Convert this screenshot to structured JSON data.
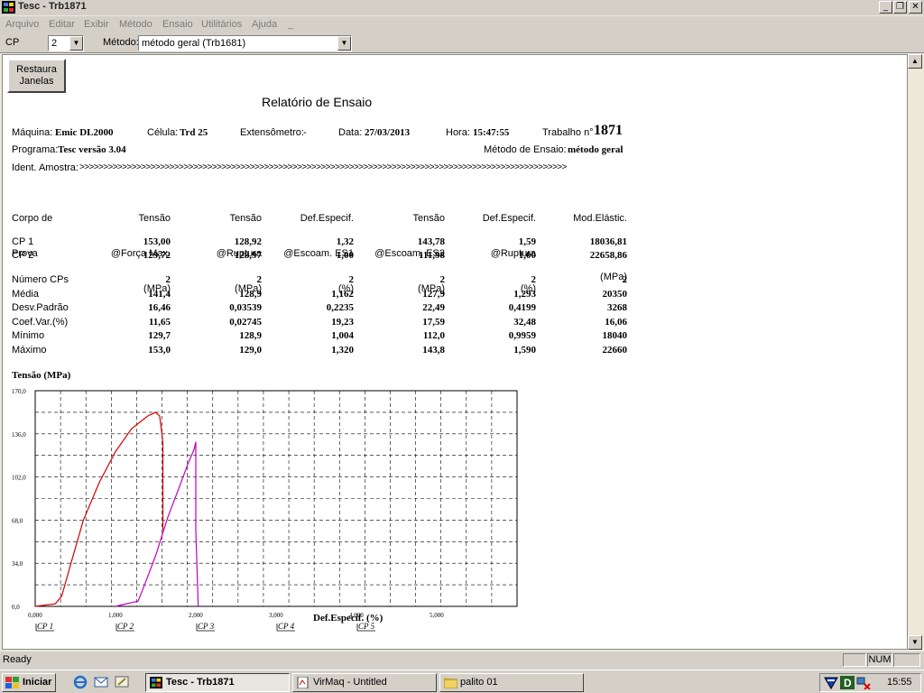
{
  "window": {
    "title": "Tesc - Trb1871",
    "controls": {
      "minimize": "_",
      "restore": "❐",
      "close": "✕"
    }
  },
  "menu": [
    "Arquivo",
    "Editar",
    "Exibir",
    "Método",
    "Ensaio",
    "Utilitários",
    "Ajuda",
    "_"
  ],
  "toolbar": {
    "cp_label": "CP",
    "cp_value": "2",
    "metodo_label": "Método:",
    "metodo_value": "método geral (Trb1681)"
  },
  "report": {
    "restore_button": [
      "Restaura",
      "Janelas"
    ],
    "title": "Relatório de Ensaio",
    "header": {
      "maquina_label": "Máquina:",
      "maquina_value": "Emic DL2000",
      "celula_label": "Célula:",
      "celula_value": "Trd 25",
      "extensometro_label": "Extensômetro:",
      "extensometro_value": "-",
      "data_label": "Data:",
      "data_value": "27/03/2013",
      "hora_label": "Hora:",
      "hora_value": "15:47:55",
      "trabalho_label": "Trabalho n°",
      "trabalho_value": "1871",
      "programa_label": "Programa:",
      "programa_value": "Tesc versão 3.04",
      "metodo_label": "Método de Ensaio:",
      "metodo_value": "método geral",
      "amostra_label": "Ident. Amostra:",
      "amostra_value": ">>>>>>>>>>>>>>>>>>>>>>>>>>>>>>>>>>>>>>>>>>>>>>>>>>>>>>>>>>>>>>>>>>>>>>>>>>>>>>>>>>>>>>>>>>>>>>>>>>>>>>>"
    },
    "columns": [
      {
        "lines": [
          "Corpo de",
          "Prova",
          ""
        ]
      },
      {
        "lines": [
          "Tensão",
          "@Força Max.",
          "(MPa)"
        ]
      },
      {
        "lines": [
          "Tensão",
          "@Ruptura",
          "(MPa)"
        ]
      },
      {
        "lines": [
          "Def.Especif.",
          "@Escoam. ES1",
          "(%)"
        ]
      },
      {
        "lines": [
          "Tensão",
          "@Escoam. ES2",
          "(MPa)"
        ]
      },
      {
        "lines": [
          "Def.Especif.",
          "@Ruptura",
          "(%)"
        ]
      },
      {
        "lines": [
          "Mod.Elástic.",
          "",
          "(MPa)"
        ]
      }
    ],
    "rows": [
      {
        "label": "CP 1",
        "values": [
          "153,00",
          "128,92",
          "1,32",
          "143,78",
          "1,59",
          "18036,81"
        ]
      },
      {
        "label": "CP 2",
        "values": [
          "129,72",
          "128,97",
          "1,00",
          "111,98",
          "1,00",
          "22658,86"
        ]
      }
    ],
    "stats": [
      {
        "label": "Número CPs",
        "values": [
          "2",
          "2",
          "2",
          "2",
          "2",
          "2"
        ]
      },
      {
        "label": "Média",
        "values": [
          "141,4",
          "128,9",
          "1,162",
          "127,9",
          "1,293",
          "20350"
        ]
      },
      {
        "label": "Desv.Padrão",
        "values": [
          "16,46",
          "0,03539",
          "0,2235",
          "22,49",
          "0,4199",
          "3268"
        ]
      },
      {
        "label": "Coef.Var.(%)",
        "values": [
          "11,65",
          "0,02745",
          "19,23",
          "17,59",
          "32,48",
          "16,06"
        ]
      },
      {
        "label": "Mínimo",
        "values": [
          "129,7",
          "128,9",
          "1,004",
          "112,0",
          "0,9959",
          "18040"
        ]
      },
      {
        "label": "Máximo",
        "values": [
          "153,0",
          "129,0",
          "1,320",
          "143,8",
          "1,590",
          "22660"
        ]
      }
    ]
  },
  "chart_data": {
    "type": "line",
    "ylabel": "Tensão (MPa)",
    "xlabel": "Def.Especif. (%)",
    "xlim": [
      0,
      6
    ],
    "ylim": [
      0,
      170
    ],
    "ytick_labels": [
      "0,0",
      "34,0",
      "68,0",
      "102,0",
      "136,0",
      "170,0"
    ],
    "xtick_labels": [
      "0,000",
      "1,000",
      "2,000",
      "3,000",
      "4,000",
      "5,000"
    ],
    "grid": true,
    "legend": [
      "CP 1",
      "CP 2",
      "CP 3",
      "CP 4",
      "CP 5"
    ],
    "series": [
      {
        "name": "CP 1",
        "color": "#d40000",
        "x": [
          0.0,
          0.25,
          0.33,
          0.45,
          0.6,
          0.8,
          1.0,
          1.2,
          1.4,
          1.5,
          1.55,
          1.58,
          1.59,
          1.59
        ],
        "y": [
          0.0,
          2.0,
          8.0,
          35.0,
          68.0,
          98.0,
          122.0,
          140.0,
          150.0,
          153.0,
          150.0,
          135.0,
          128.92,
          60.0
        ]
      },
      {
        "name": "CP 2",
        "color": "#c000c0",
        "x": [
          1.0,
          1.1,
          1.2,
          1.28,
          1.35,
          1.5,
          1.65,
          1.8,
          1.9,
          1.98,
          2.0,
          2.0,
          2.03
        ],
        "y": [
          0.0,
          1.5,
          3.0,
          4.0,
          15.0,
          40.0,
          70.0,
          95.0,
          112.0,
          124.0,
          129.7,
          60.0,
          0.0
        ]
      }
    ]
  },
  "statusbar": {
    "ready": "Ready",
    "num": "NUM"
  },
  "taskbar": {
    "start": "Iniciar",
    "buttons": [
      "Tesc - Trb1871",
      "VirMaq - Untitled",
      "palito 01"
    ],
    "clock": "15:55"
  }
}
